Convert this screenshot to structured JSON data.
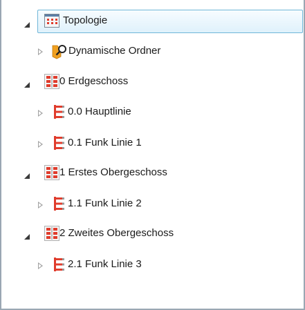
{
  "tree": {
    "root": {
      "label": "Topologie",
      "icon": "topology-icon",
      "expanded": true,
      "selected": true
    },
    "dynamic_folders": {
      "label": "Dynamische Ordner",
      "icon": "folder-search-icon",
      "expanded": false
    },
    "areas": [
      {
        "label": "0 Erdgeschoss",
        "icon": "area-icon",
        "expanded": true,
        "lines": [
          {
            "label": "0.0 Hauptlinie",
            "icon": "line-icon",
            "expanded": false
          },
          {
            "label": "0.1 Funk Linie 1",
            "icon": "line-icon",
            "expanded": false
          }
        ]
      },
      {
        "label": "1 Erstes Obergeschoss",
        "icon": "area-icon",
        "expanded": true,
        "lines": [
          {
            "label": "1.1 Funk Linie 2",
            "icon": "line-icon",
            "expanded": false
          }
        ]
      },
      {
        "label": "2 Zweites Obergeschoss",
        "icon": "area-icon",
        "expanded": true,
        "lines": [
          {
            "label": "2.1 Funk Linie 3",
            "icon": "line-icon",
            "expanded": false
          }
        ]
      }
    ]
  },
  "colors": {
    "accent": "#e03c2c",
    "folder": "#f0a020",
    "selection_border": "#6fb6d8",
    "frame": "#9aa7b3"
  }
}
